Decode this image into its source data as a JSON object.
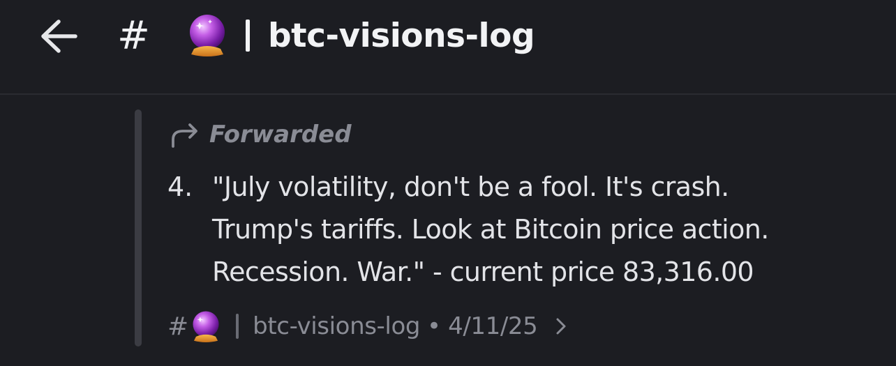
{
  "header": {
    "back_icon": "arrow-left-icon",
    "hash_symbol": "#",
    "channel_emoji": "crystal-ball-icon",
    "channel_name": "btc-visions-log"
  },
  "message": {
    "forwarded_icon": "forward-arrow-icon",
    "forwarded_label": "Forwarded",
    "number": "4.",
    "lines": [
      "\"July volatility, don't be a fool. It's crash.",
      "Trump's tariffs. Look at Bitcoin price action.",
      "Recession. War.\" - current price 83,316.00"
    ],
    "source": {
      "hash_symbol": "#",
      "channel_emoji": "crystal-ball-icon",
      "channel_name": "btc-visions-log",
      "separator": "•",
      "date": "4/11/25",
      "chevron_icon": "chevron-right-icon"
    }
  },
  "colors": {
    "background": "#1c1d22",
    "text_primary": "#f2f3f5",
    "text_muted": "#8a8c95",
    "quote_bar": "#3b3c43"
  }
}
